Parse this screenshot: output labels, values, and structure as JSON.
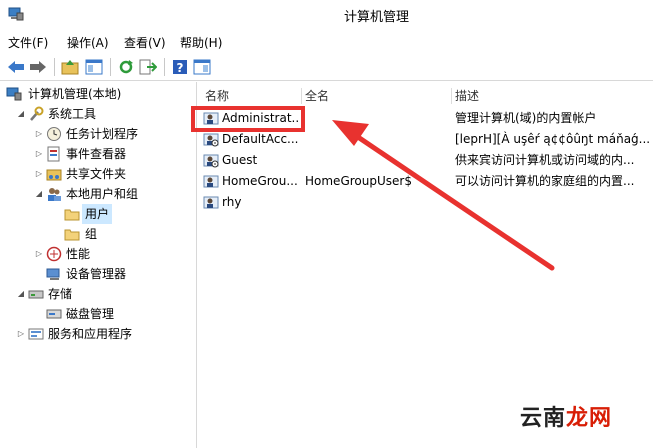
{
  "window": {
    "title": "计算机管理"
  },
  "menubar": {
    "items": [
      "文件(F)",
      "操作(A)",
      "查看(V)",
      "帮助(H)"
    ]
  },
  "tree": {
    "root": "计算机管理(本地)",
    "system_tools": "系统工具",
    "task_scheduler": "任务计划程序",
    "event_viewer": "事件查看器",
    "shared_folders": "共享文件夹",
    "local_users_groups": "本地用户和组",
    "users": "用户",
    "groups": "组",
    "performance": "性能",
    "device_manager": "设备管理器",
    "storage": "存储",
    "disk_management": "磁盘管理",
    "services_apps": "服务和应用程序"
  },
  "list": {
    "headers": {
      "name": "名称",
      "fullname": "全名",
      "description": "描述"
    },
    "rows": [
      {
        "name": "Administrat...",
        "fullname": "",
        "description": "管理计算机(域)的内置帐户"
      },
      {
        "name": "DefaultAcc...",
        "fullname": "",
        "description": "[leprH][À uşêŕ ą¢¢ôûŋt máňaǵ..."
      },
      {
        "name": "Guest",
        "fullname": "",
        "description": "供来宾访问计算机或访问域的内..."
      },
      {
        "name": "HomeGrou...",
        "fullname": "HomeGroupUser$",
        "description": "可以访问计算机的家庭组的内置..."
      },
      {
        "name": "rhy",
        "fullname": "",
        "description": ""
      }
    ]
  },
  "watermark": {
    "part1": "云南",
    "part2": "龙网"
  },
  "colors": {
    "highlight": "#e8322f",
    "watermark_red": "#d81e06"
  }
}
